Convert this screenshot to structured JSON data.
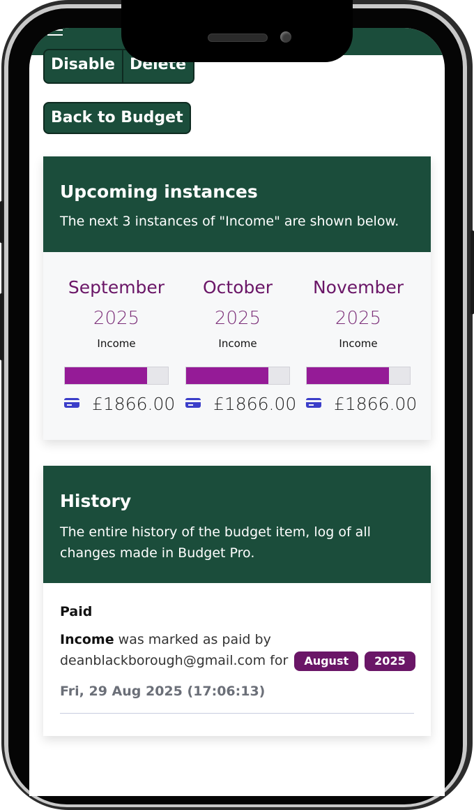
{
  "actions": {
    "disable_label": "Disable",
    "delete_label": "Delete",
    "back_label": "Back to Budget"
  },
  "upcoming": {
    "title": "Upcoming instances",
    "subtitle": "The next 3 instances of \"Income\" are shown below.",
    "instances": [
      {
        "month": "September",
        "year": "2025",
        "name": "Income",
        "amount": "£1866.00",
        "progress": 0.8
      },
      {
        "month": "October",
        "year": "2025",
        "name": "Income",
        "amount": "£1866.00",
        "progress": 0.8
      },
      {
        "month": "November",
        "year": "2025",
        "name": "Income",
        "amount": "£1866.00",
        "progress": 0.8
      }
    ]
  },
  "history": {
    "title": "History",
    "subtitle": "The entire history of the budget item, log of all changes made in Budget Pro.",
    "entries": [
      {
        "type": "Paid",
        "item": "Income",
        "text": "was marked as paid by",
        "user": "deanblackborough@gmail.com",
        "for_word": "for",
        "month_badge": "August",
        "year_badge": "2025",
        "timestamp": "Fri, 29 Aug 2025 (17:06:13)"
      }
    ]
  },
  "colors": {
    "brand": "#1b4d3b",
    "accent": "#6a1667",
    "progress": "#951b97",
    "card_icon": "#3b3ec9"
  },
  "icons": {
    "menu": "hamburger-icon",
    "payment": "credit-card-icon"
  }
}
